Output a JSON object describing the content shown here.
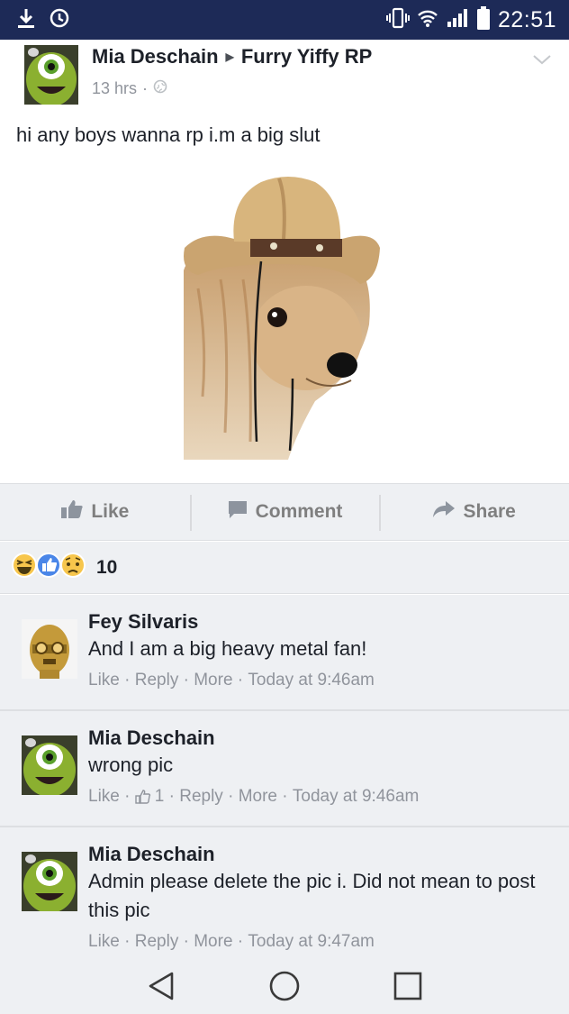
{
  "status_bar": {
    "time": "22:51",
    "icons": [
      "download-icon",
      "history-icon",
      "vibrate-icon",
      "wifi-icon",
      "signal-icon",
      "battery-icon"
    ]
  },
  "post": {
    "author": "Mia Deschain",
    "group": "Furry Yiffy RP",
    "time": "13 hrs",
    "text": "hi any boys wanna rp i.m a big slut"
  },
  "actions": {
    "like": "Like",
    "comment": "Comment",
    "share": "Share"
  },
  "reactions": {
    "count": "10",
    "icons": [
      "haha-icon",
      "like-icon",
      "sad-icon"
    ]
  },
  "comments": [
    {
      "author": "Fey Silvaris",
      "text": "And I am a big heavy metal fan!",
      "like": "Like",
      "reply": "Reply",
      "more": "More",
      "time": "Today at 9:46am"
    },
    {
      "author": "Mia Deschain",
      "text": "wrong pic",
      "like": "Like",
      "likes_count": "1",
      "reply": "Reply",
      "more": "More",
      "time": "Today at 9:46am"
    },
    {
      "author": "Mia Deschain",
      "text": "Admin please delete the pic i. Did not mean to post this pic",
      "like": "Like",
      "reply": "Reply",
      "more": "More",
      "time": "Today at 9:47am"
    }
  ],
  "colors": {
    "status_bar": "#1d2a57",
    "feed_bg": "#eef0f3",
    "meta_gray": "#90949c",
    "like_blue": "#4267b2"
  }
}
